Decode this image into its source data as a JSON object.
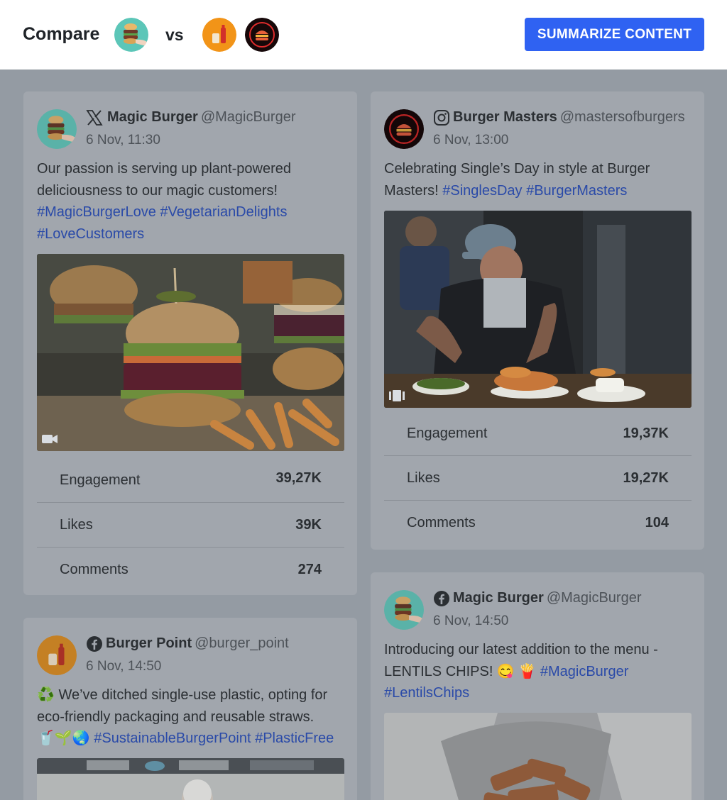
{
  "header": {
    "compare_label": "Compare",
    "vs_label": "vs",
    "summarize_button": "SUMMARIZE CONTENT",
    "accent_color": "#2f62f2",
    "avatars": [
      "magic-burger-avatar",
      "burger-point-avatar",
      "burger-masters-avatar"
    ]
  },
  "posts": [
    {
      "platform": "x",
      "author": "Magic Burger",
      "handle": "@MagicBurger",
      "date": "6 Nov, 11:30",
      "text_lines": [
        "Our passion is serving up plant-powered",
        "deliciousness to our magic customers!"
      ],
      "hashtags_line1": "#MagicBurgerLove #VegetarianDelights",
      "hashtags_line2": "#LoveCustomers",
      "media_type": "video-icon",
      "stats": [
        {
          "label": "Engagement",
          "value": "39,27K"
        },
        {
          "label": "Likes",
          "value": "39K"
        },
        {
          "label": "Comments",
          "value": "274"
        }
      ]
    },
    {
      "platform": "instagram",
      "author": "Burger Masters",
      "handle": "@mastersofburgers",
      "date": "6 Nov, 13:00",
      "text_line1": "Celebrating Single’s Day in style at Burger",
      "text_line2_prefix": "Masters! ",
      "hashtags": "#SinglesDay #BurgerMasters",
      "media_type": "carousel-icon",
      "stats": [
        {
          "label": "Engagement",
          "value": "19,37K"
        },
        {
          "label": "Likes",
          "value": "19,27K"
        },
        {
          "label": "Comments",
          "value": "104"
        }
      ]
    },
    {
      "platform": "facebook",
      "author": "Burger Point",
      "handle": "@burger_point",
      "date": "6 Nov, 14:50",
      "text_line1": "♻️ We’ve ditched single-use plastic, opting for",
      "text_line2": "eco-friendly packaging and reusable straws.",
      "emojis": "🥤🌱🌏",
      "hashtags": "#SustainableBurgerPoint #PlasticFree"
    },
    {
      "platform": "facebook",
      "author": "Magic Burger",
      "handle": "@MagicBurger",
      "date": "6 Nov, 14:50",
      "text_line1": "Introducing our latest addition to the menu -",
      "text_line2_prefix": "LENTILS CHIPS! 😋 🍟 ",
      "hashtag_inline": "#MagicBurger",
      "hashtag_line3": "#LentilsChips"
    }
  ]
}
